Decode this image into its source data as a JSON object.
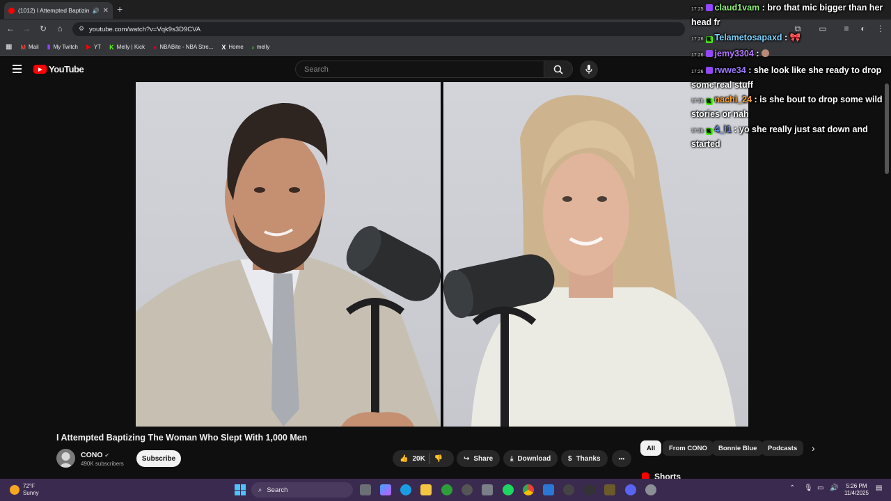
{
  "browser": {
    "tab_title": "(1012) I Attempted Baptizin",
    "url": "youtube.com/watch?v=Vqk9s3D9CVA",
    "bookmarks": [
      {
        "label": "Mail",
        "icon": "gmail-icon",
        "color": "#ea4335",
        "glyph": "M"
      },
      {
        "label": "My Twitch",
        "icon": "twitch-icon",
        "color": "#9146ff",
        "glyph": "▮"
      },
      {
        "label": "YT",
        "icon": "youtube-icon",
        "color": "#ff0000",
        "glyph": "▶"
      },
      {
        "label": "Melly | Kick",
        "icon": "kick-icon",
        "color": "#53fc18",
        "glyph": "K"
      },
      {
        "label": "NBABite - NBA Stre...",
        "icon": "nba-icon",
        "color": "#c9082a",
        "glyph": "●"
      },
      {
        "label": "Home",
        "icon": "x-icon",
        "color": "#ffffff",
        "glyph": "X"
      },
      {
        "label": "melly",
        "icon": "kick-green-icon",
        "color": "#53fc18",
        "glyph": "›"
      }
    ]
  },
  "youtube": {
    "logo_text": "YouTube",
    "search_placeholder": "Search"
  },
  "chat": [
    {
      "time": "17:25",
      "user": "claud1vam",
      "user_color": "#8ff07a",
      "badge": "purple",
      "text": ": bro that mic bigger than her head fr"
    },
    {
      "time": "17:26",
      "user": "Telametosapaxd",
      "user_color": "#7fd3ff",
      "badge": "green",
      "text": ":"
    },
    {
      "time": "17:26",
      "user": "jemy3304",
      "user_color": "#b57cff",
      "badge": "purple",
      "text": ":"
    },
    {
      "time": "17:26",
      "user": "rwwe34",
      "user_color": "#9d7bff",
      "badge": "purple",
      "text": ": she look like she ready to drop some real stuff"
    },
    {
      "time": "17:26",
      "user": "nachi_24",
      "user_color": "#ff9f2e",
      "badge": "green",
      "text": ": is she bout to drop some wild stories or nah"
    },
    {
      "time": "17:26",
      "user": "4_l1",
      "user_color": "#5b8cff",
      "badge": "green",
      "text": ": yo she really just sat down and started"
    }
  ],
  "video": {
    "title": "I Attempted Baptizing The Woman Who Slept With 1,000 Men",
    "channel": "CONO",
    "subscribers": "490K subscribers",
    "subscribe_label": "Subscribe",
    "likes": "20K",
    "share_label": "Share",
    "download_label": "Download",
    "thanks_label": "Thanks",
    "more_label": "•••"
  },
  "chips": [
    "All",
    "From CONO",
    "Bonnie Blue",
    "Podcasts"
  ],
  "shorts_label": "Shorts",
  "taskbar": {
    "temp": "72°F",
    "condition": "Sunny",
    "search_label": "Search",
    "time": "5:26 PM",
    "date": "11/4/2025"
  }
}
